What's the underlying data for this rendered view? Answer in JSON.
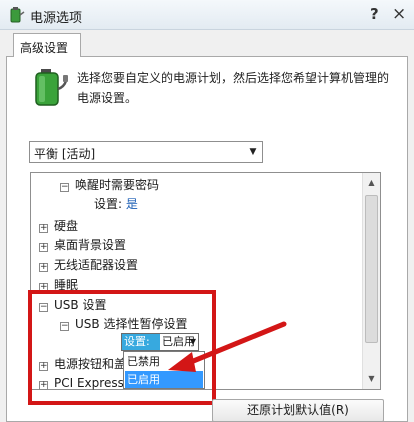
{
  "window": {
    "title": "电源选项",
    "help_label": "?",
    "close_label": "×"
  },
  "tab": {
    "label": "高级设置"
  },
  "description": "选择您要自定义的电源计划，然后选择您希望计算机管理的电源设置。",
  "plan_select": {
    "value": "平衡 [活动]"
  },
  "tree": {
    "wake_password": "唤醒时需要密码",
    "wake_setting_label": "设置:",
    "wake_setting_value": "是",
    "hard_disk": "硬盘",
    "desktop_background": "桌面背景设置",
    "wireless_adapter": "无线适配器设置",
    "sleep": "睡眠",
    "usb_settings": "USB 设置",
    "usb_selective_suspend": "USB 选择性暂停设置",
    "setting_label": "设置:",
    "setting_value": "已启用",
    "power_buttons": "电源按钮和盖",
    "pci_express": "PCI Express"
  },
  "dropdown": {
    "options": [
      "已禁用",
      "已启用"
    ],
    "selected": "已启用"
  },
  "buttons": {
    "restore_defaults": "还原计划默认值(R)"
  },
  "colors": {
    "highlight_box": "#d31616",
    "selection_blue": "#3399ff",
    "link_blue": "#1a5db4"
  }
}
